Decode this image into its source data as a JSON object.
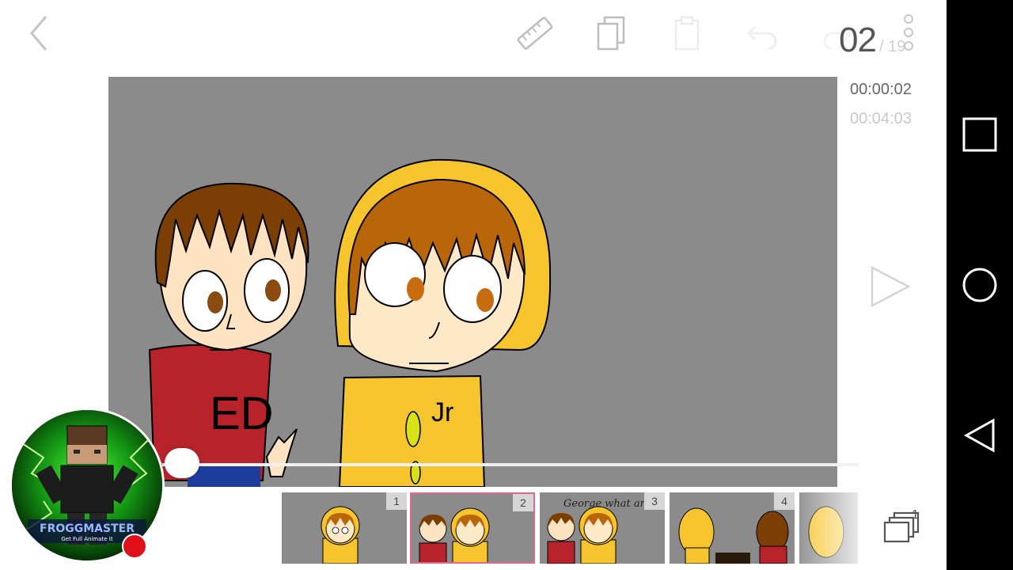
{
  "toolbar": {
    "back_icon": "chevron-left-icon",
    "ruler_icon": "ruler-icon",
    "copy_icon": "copy-icon",
    "paste_icon": "paste-icon",
    "undo_icon": "undo-icon",
    "redo_icon": "redo-icon",
    "more_icon": "vertical-dots-icon"
  },
  "frame_counter": {
    "current": "02",
    "total": "/ 19"
  },
  "playback": {
    "current_time": "00:00:02",
    "total_time": "00:04:03",
    "play_icon": "play-icon",
    "scrub_progress": 0.05
  },
  "canvas": {
    "background": "#8b8b8b",
    "shirt_text_left": "ED",
    "shirt_text_right": "Jr"
  },
  "filmstrip": {
    "selected_index": 1,
    "frames": [
      {
        "number": "1"
      },
      {
        "number": "2"
      },
      {
        "number": "3",
        "caption": "George what are you lookin at?"
      },
      {
        "number": "4"
      }
    ]
  },
  "layers": {
    "icon": "layers-icon",
    "count": "1"
  },
  "overlay": {
    "avatar_icon": "channel-avatar",
    "avatar_name": "FROGGMASTER",
    "avatar_tagline": "Get Full Animate It",
    "record_icon": "record-dot-icon"
  },
  "system_nav": {
    "recents_icon": "recents-square-icon",
    "home_icon": "home-circle-icon",
    "back_icon": "back-triangle-icon"
  },
  "colors": {
    "accent_selected": "#e3668e",
    "record": "#e0101a",
    "yellow_hoodie": "#f6c52e",
    "red_shirt": "#b7222b",
    "hair_brown": "#7b3f06"
  }
}
